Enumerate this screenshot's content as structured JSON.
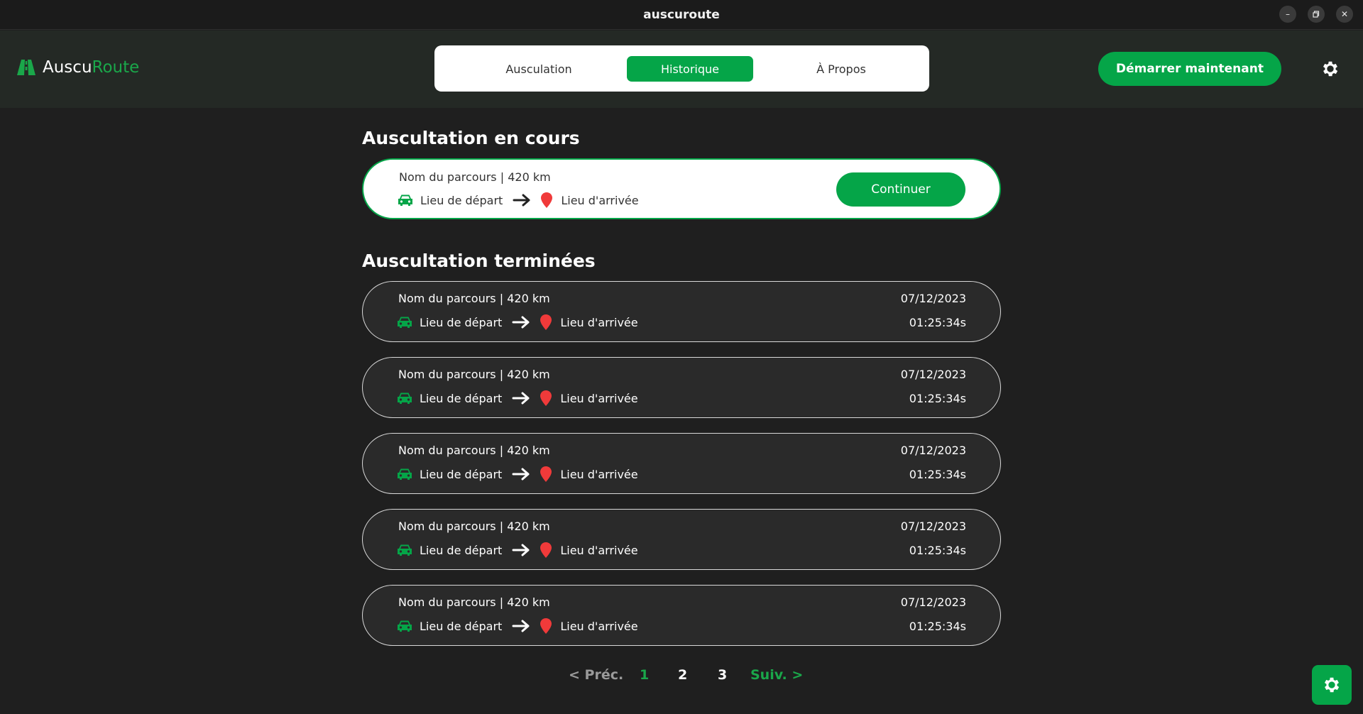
{
  "window": {
    "title": "auscuroute",
    "controls": [
      "minimize-icon",
      "restore-icon",
      "close-icon"
    ]
  },
  "header": {
    "logo_part1": "Auscu",
    "logo_part2": "Route",
    "tabs": [
      {
        "label": "Ausculation",
        "active": false
      },
      {
        "label": "Historique",
        "active": true
      },
      {
        "label": "À Propos",
        "active": false
      }
    ],
    "start_button": "Démarrer maintenant",
    "settings_icon": "gear-icon"
  },
  "colors": {
    "accent": "#05a548",
    "background": "#1f1f1f",
    "card": "#2a2a2a",
    "pin": "#f03a3a"
  },
  "current": {
    "title": "Auscultation en cours",
    "route_name": "Nom du parcours | 420 km",
    "departure": "Lieu de départ",
    "arrival": "Lieu d'arrivée",
    "continue_label": "Continuer"
  },
  "finished": {
    "title": "Auscultation terminées",
    "items": [
      {
        "route_name": "Nom du parcours | 420 km",
        "departure": "Lieu de départ",
        "arrival": "Lieu d'arrivée",
        "date": "07/12/2023",
        "duration": "01:25:34s"
      },
      {
        "route_name": "Nom du parcours | 420 km",
        "departure": "Lieu de départ",
        "arrival": "Lieu d'arrivée",
        "date": "07/12/2023",
        "duration": "01:25:34s"
      },
      {
        "route_name": "Nom du parcours | 420 km",
        "departure": "Lieu de départ",
        "arrival": "Lieu d'arrivée",
        "date": "07/12/2023",
        "duration": "01:25:34s"
      },
      {
        "route_name": "Nom du parcours | 420 km",
        "departure": "Lieu de départ",
        "arrival": "Lieu d'arrivée",
        "date": "07/12/2023",
        "duration": "01:25:34s"
      },
      {
        "route_name": "Nom du parcours | 420 km",
        "departure": "Lieu de départ",
        "arrival": "Lieu d'arrivée",
        "date": "07/12/2023",
        "duration": "01:25:34s"
      }
    ]
  },
  "pagination": {
    "prev": "< Préc.",
    "pages": [
      "1",
      "2",
      "3"
    ],
    "current_page": "1",
    "next": "Suiv. >"
  },
  "fab_icon": "gear-icon"
}
